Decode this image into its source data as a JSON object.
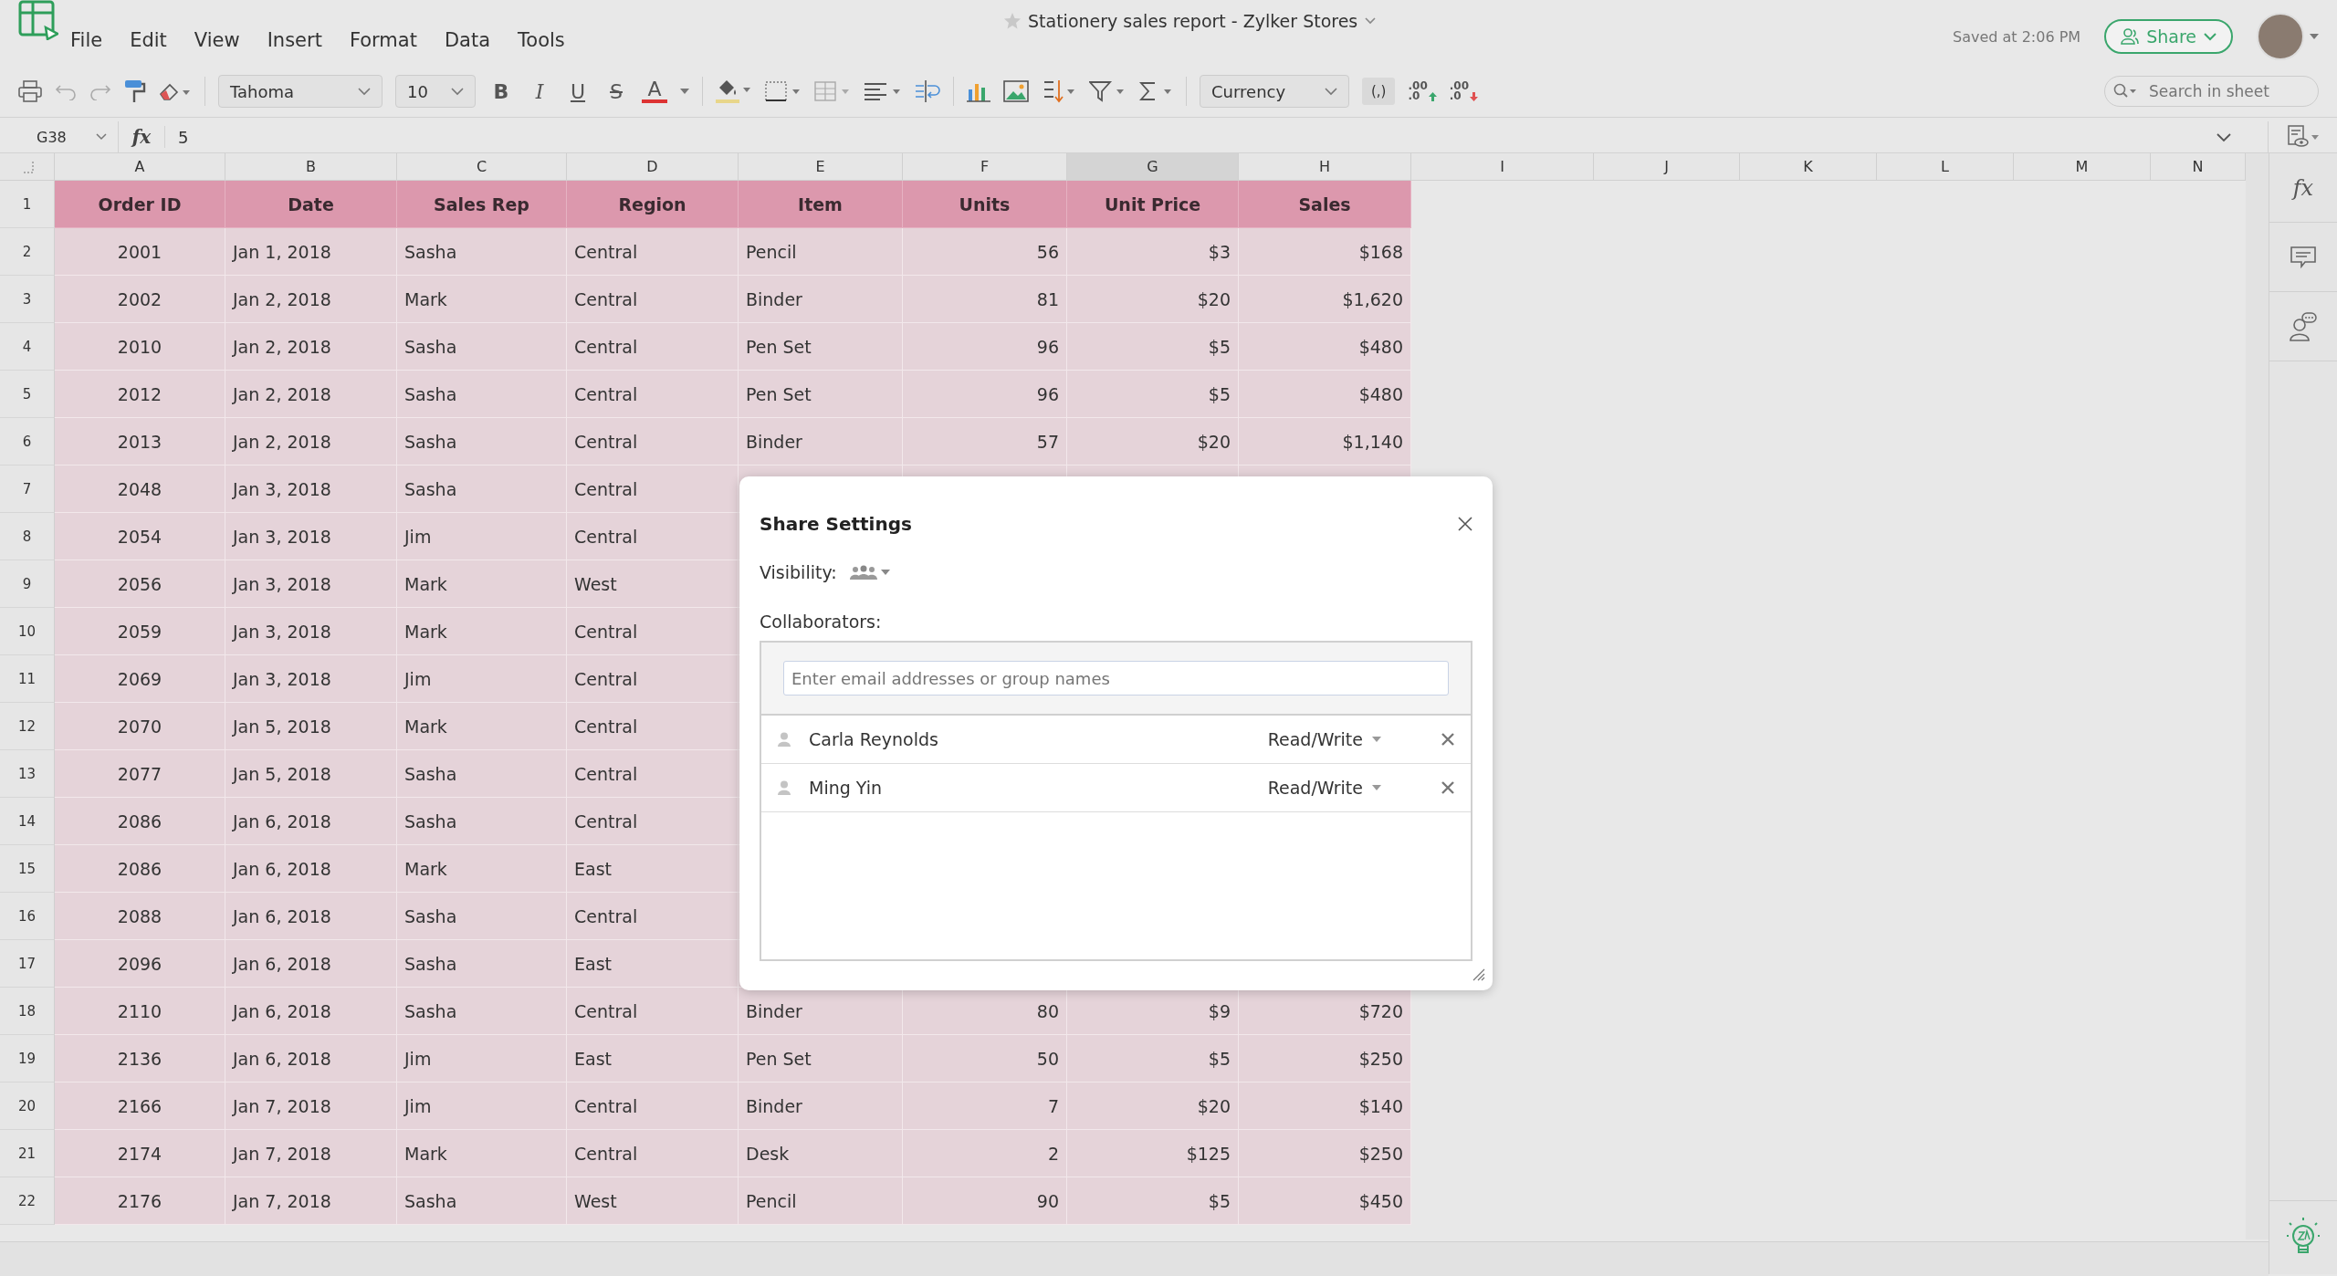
{
  "app": {
    "title": "Stationery sales report - Zylker Stores",
    "saved": "Saved at 2:06 PM",
    "share_button": "Share"
  },
  "menu": [
    "File",
    "Edit",
    "View",
    "Insert",
    "Format",
    "Data",
    "Tools"
  ],
  "toolbar": {
    "font": "Tahoma",
    "font_size": "10",
    "format_buttons": [
      "B",
      "I",
      "U",
      "S",
      "A"
    ],
    "number_format": "Currency",
    "comma_button": "(,)",
    "decimal_buttons": [
      {
        "kind": "increase",
        "top": ".00",
        "bottom": ".0"
      },
      {
        "kind": "decrease",
        "top": ".00",
        "bottom": ".0"
      }
    ],
    "search_placeholder": "Search in sheet"
  },
  "formula_bar": {
    "cell_ref": "G38",
    "fx": "fx",
    "value": "5"
  },
  "sidebar": {
    "fx": "fx"
  },
  "sheet": {
    "columns": [
      {
        "label": "A",
        "selected": false,
        "kind": "id"
      },
      {
        "label": "B",
        "selected": false,
        "kind": "text"
      },
      {
        "label": "C",
        "selected": false,
        "kind": "text"
      },
      {
        "label": "D",
        "selected": false,
        "kind": "text"
      },
      {
        "label": "E",
        "selected": false,
        "kind": "text"
      },
      {
        "label": "F",
        "selected": false,
        "kind": "number"
      },
      {
        "label": "G",
        "selected": true,
        "kind": "number"
      },
      {
        "label": "H",
        "selected": false,
        "kind": "number"
      },
      {
        "label": "I",
        "selected": false
      },
      {
        "label": "J",
        "selected": false
      },
      {
        "label": "K",
        "selected": false
      },
      {
        "label": "L",
        "selected": false
      },
      {
        "label": "M",
        "selected": false
      },
      {
        "label": "N",
        "selected": false
      }
    ],
    "rows": [
      {
        "number": "1",
        "kind": "header",
        "cells": [
          "Order ID",
          "Date",
          "Sales Rep",
          "Region",
          "Item",
          "Units",
          "Unit Price",
          "Sales"
        ]
      },
      {
        "number": "2",
        "kind": "data",
        "cells": [
          "2001",
          "Jan 1, 2018",
          "Sasha",
          "Central",
          "Pencil",
          "56",
          "$3",
          "$168"
        ]
      },
      {
        "number": "3",
        "kind": "data",
        "cells": [
          "2002",
          "Jan 2, 2018",
          "Mark",
          "Central",
          "Binder",
          "81",
          "$20",
          "$1,620"
        ]
      },
      {
        "number": "4",
        "kind": "data",
        "cells": [
          "2010",
          "Jan 2, 2018",
          "Sasha",
          "Central",
          "Pen Set",
          "96",
          "$5",
          "$480"
        ]
      },
      {
        "number": "5",
        "kind": "data",
        "cells": [
          "2012",
          "Jan 2, 2018",
          "Sasha",
          "Central",
          "Pen Set",
          "96",
          "$5",
          "$480"
        ]
      },
      {
        "number": "6",
        "kind": "data",
        "cells": [
          "2013",
          "Jan 2, 2018",
          "Sasha",
          "Central",
          "Binder",
          "57",
          "$20",
          "$1,140"
        ]
      },
      {
        "number": "7",
        "kind": "data",
        "cells": [
          "2048",
          "Jan 3, 2018",
          "Sasha",
          "Central"
        ]
      },
      {
        "number": "8",
        "kind": "data",
        "cells": [
          "2054",
          "Jan 3, 2018",
          "Jim",
          "Central"
        ]
      },
      {
        "number": "9",
        "kind": "data",
        "cells": [
          "2056",
          "Jan 3, 2018",
          "Mark",
          "West"
        ]
      },
      {
        "number": "10",
        "kind": "data",
        "cells": [
          "2059",
          "Jan 3, 2018",
          "Mark",
          "Central"
        ]
      },
      {
        "number": "11",
        "kind": "data",
        "cells": [
          "2069",
          "Jan 3, 2018",
          "Jim",
          "Central"
        ]
      },
      {
        "number": "12",
        "kind": "data",
        "cells": [
          "2070",
          "Jan 5, 2018",
          "Mark",
          "Central"
        ]
      },
      {
        "number": "13",
        "kind": "data",
        "cells": [
          "2077",
          "Jan 5, 2018",
          "Sasha",
          "Central"
        ]
      },
      {
        "number": "14",
        "kind": "data",
        "cells": [
          "2086",
          "Jan 6, 2018",
          "Sasha",
          "Central"
        ]
      },
      {
        "number": "15",
        "kind": "data",
        "cells": [
          "2086",
          "Jan 6, 2018",
          "Mark",
          "East"
        ]
      },
      {
        "number": "16",
        "kind": "data",
        "cells": [
          "2088",
          "Jan 6, 2018",
          "Sasha",
          "Central"
        ]
      },
      {
        "number": "17",
        "kind": "data",
        "cells": [
          "2096",
          "Jan 6, 2018",
          "Sasha",
          "East"
        ]
      },
      {
        "number": "18",
        "kind": "data",
        "cells": [
          "2110",
          "Jan 6, 2018",
          "Sasha",
          "Central",
          "Binder",
          "80",
          "$9",
          "$720"
        ]
      },
      {
        "number": "19",
        "kind": "data",
        "cells": [
          "2136",
          "Jan 6, 2018",
          "Jim",
          "East",
          "Pen Set",
          "50",
          "$5",
          "$250"
        ]
      },
      {
        "number": "20",
        "kind": "data",
        "cells": [
          "2166",
          "Jan 7, 2018",
          "Jim",
          "Central",
          "Binder",
          "7",
          "$20",
          "$140"
        ]
      },
      {
        "number": "21",
        "kind": "data",
        "cells": [
          "2174",
          "Jan 7, 2018",
          "Mark",
          "Central",
          "Desk",
          "2",
          "$125",
          "$250"
        ]
      },
      {
        "number": "22",
        "kind": "data",
        "cells": [
          "2176",
          "Jan 7, 2018",
          "Sasha",
          "West",
          "Pencil",
          "90",
          "$5",
          "$450"
        ]
      }
    ]
  },
  "dialog": {
    "title": "Share Settings",
    "visibility_label": "Visibility:",
    "collaborators_label": "Collaborators:",
    "placeholder": "Enter email addresses or group names",
    "collaborators": [
      {
        "name": "Carla Reynolds",
        "permission": "Read/Write"
      },
      {
        "name": "Ming Yin",
        "permission": "Read/Write"
      }
    ]
  }
}
